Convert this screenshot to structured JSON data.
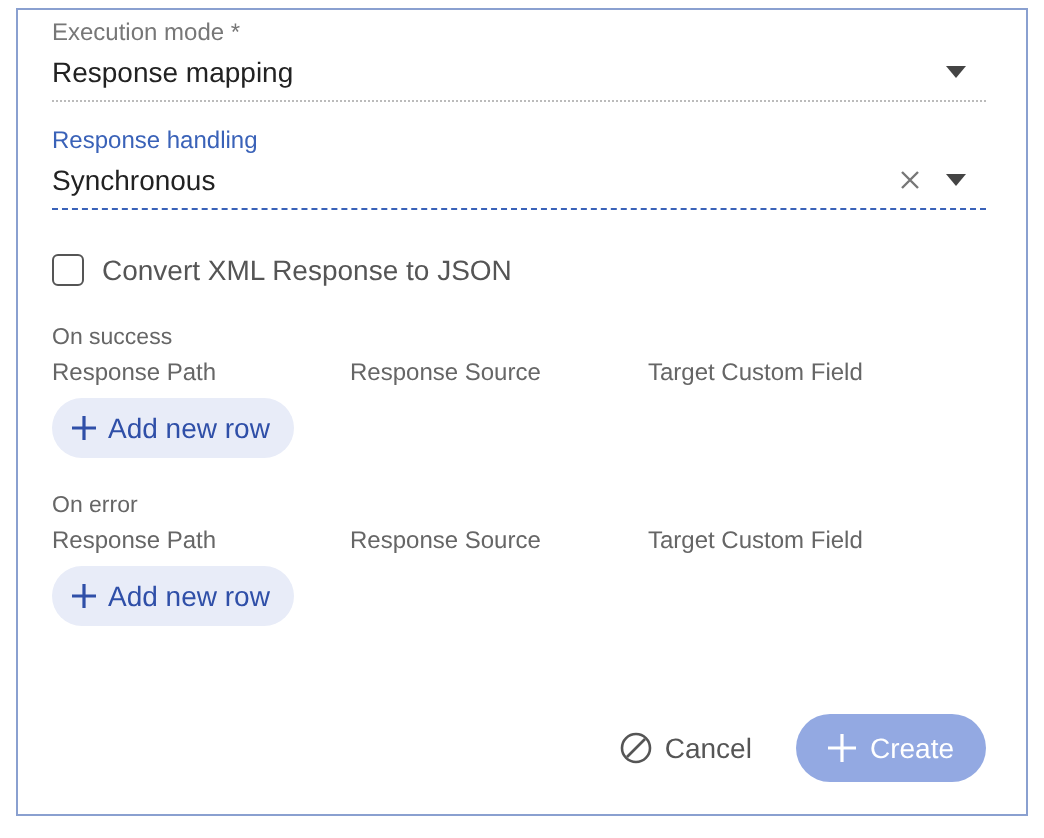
{
  "fields": [
    {
      "label": "Execution mode *",
      "value": "Response mapping",
      "focused": false,
      "clearable": false
    },
    {
      "label": "Response handling",
      "value": "Synchronous",
      "focused": true,
      "clearable": true
    }
  ],
  "checkbox": {
    "label": "Convert XML Response to JSON",
    "checked": false
  },
  "sections": [
    {
      "title": "On success",
      "columns": [
        "Response Path",
        "Response Source",
        "Target Custom Field"
      ],
      "add_button": "Add new row"
    },
    {
      "title": "On error",
      "columns": [
        "Response Path",
        "Response Source",
        "Target Custom Field"
      ],
      "add_button": "Add new row"
    }
  ],
  "footer": {
    "cancel": "Cancel",
    "create": {
      "label": "Create",
      "disabled": true
    }
  }
}
